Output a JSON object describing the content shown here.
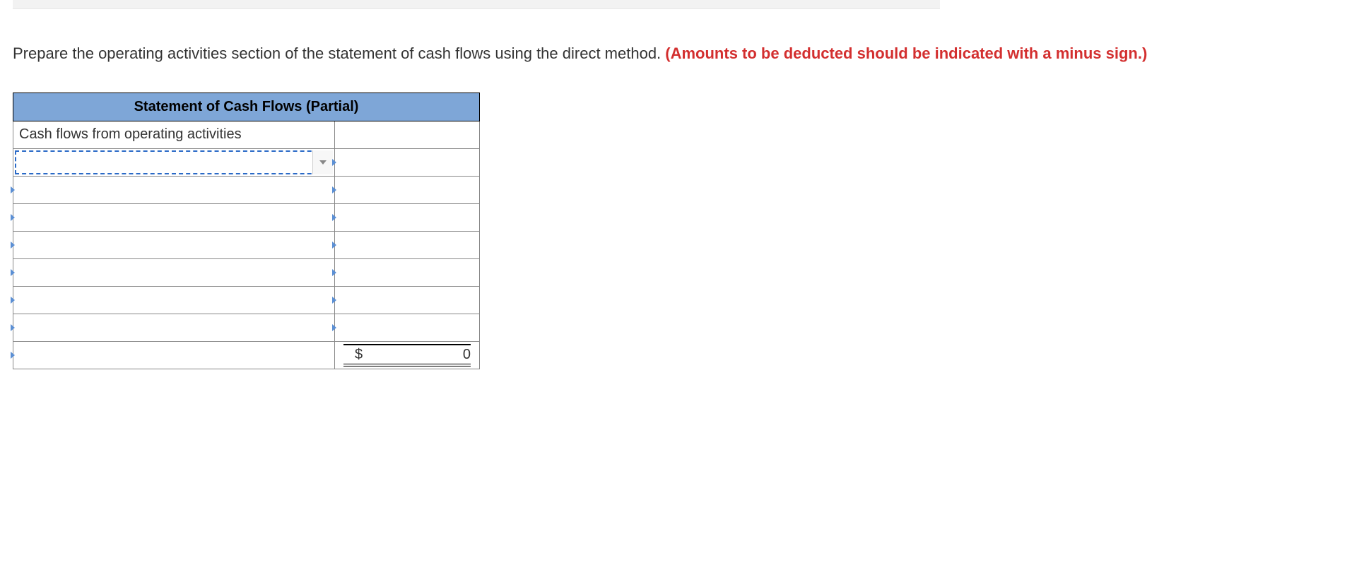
{
  "instruction": {
    "plain": "Prepare the operating activities section of the statement of cash flows using the direct method. ",
    "emph": "(Amounts to be deducted should be indicated with a minus sign.)"
  },
  "table": {
    "title": "Statement of Cash Flows (Partial)",
    "section_label": "Cash flows from operating activities",
    "rows": [
      {
        "label": "",
        "value": ""
      },
      {
        "label": "",
        "value": ""
      },
      {
        "label": "",
        "value": ""
      },
      {
        "label": "",
        "value": ""
      },
      {
        "label": "",
        "value": ""
      },
      {
        "label": "",
        "value": ""
      },
      {
        "label": "",
        "value": ""
      }
    ],
    "total": {
      "label": "",
      "currency": "$",
      "value": "0"
    }
  }
}
